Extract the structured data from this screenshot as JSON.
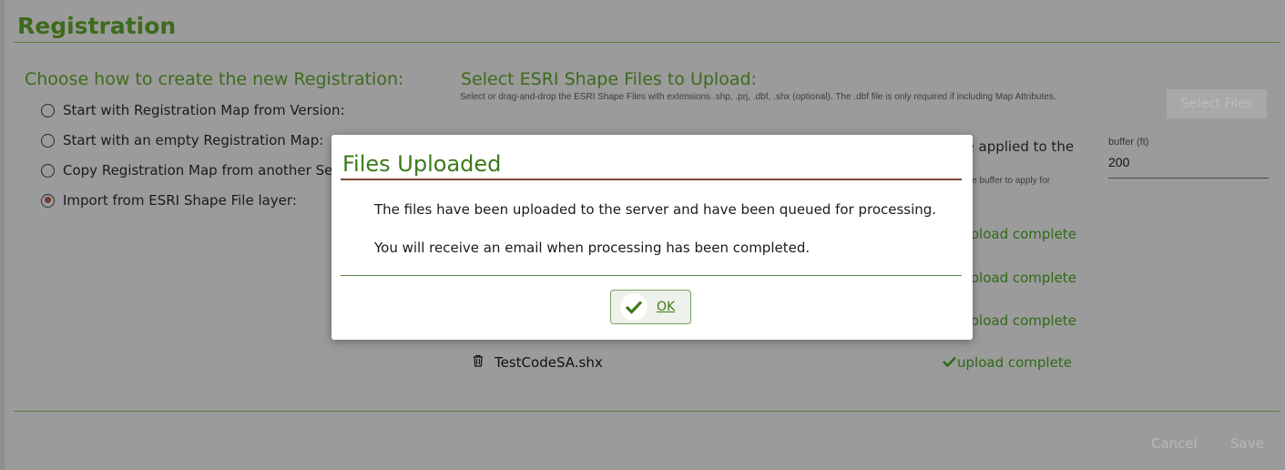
{
  "page": {
    "title": "Registration",
    "left_heading": "Choose how to create the new Registration:",
    "right_heading": "Select ESRI Shape Files to Upload:",
    "help_text": "Select or drag-and-drop the ESRI Shape Files with extensions .shp, .prj, .dbf, .shx (optional). The .dbf file is only required if including Map Attributes.",
    "select_files_label": "Select Files"
  },
  "options": [
    {
      "label": "Start with Registration Map from Version:",
      "checked": false
    },
    {
      "label": "Start with an empty Registration Map:",
      "checked": false
    },
    {
      "label": "Copy Registration Map from another Se",
      "checked": false
    },
    {
      "label": "Import from ESRI Shape File layer:",
      "checked": true
    }
  ],
  "buffer": {
    "label": "buffer (ft)",
    "value": "200",
    "partial_text_1": "be applied to the",
    "partial_text_2": "s the buffer to apply for"
  },
  "uploads": {
    "status_label": "upload complete",
    "file_name": "TestCodeSA.shx"
  },
  "footer": {
    "cancel_label": "Cancel",
    "save_label": "Save"
  },
  "modal": {
    "title": "Files Uploaded",
    "message_1": "The files have been uploaded to the server and have been queued for processing.",
    "message_2": "You will receive an email when processing has been completed.",
    "ok_label": "OK"
  },
  "colors": {
    "accent": "#3d7a1b",
    "overlay": "#9b9b9b",
    "modal_rule": "#7b4a34"
  }
}
